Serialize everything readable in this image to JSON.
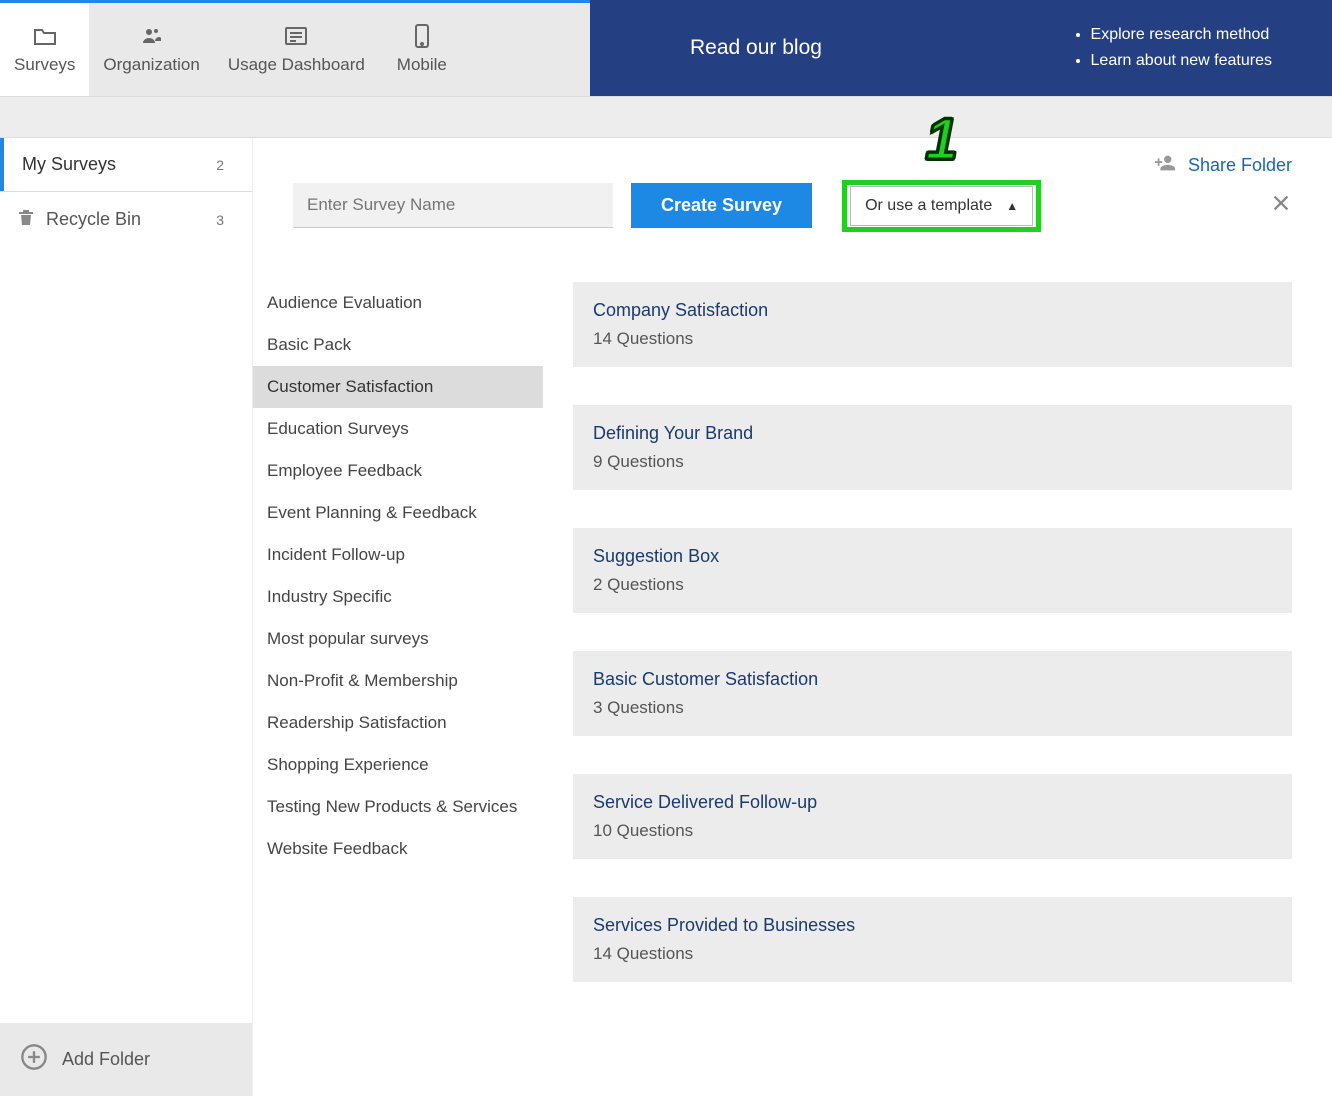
{
  "topnav": [
    {
      "label": "Surveys",
      "icon": "folder",
      "active": true
    },
    {
      "label": "Organization",
      "icon": "people",
      "active": false
    },
    {
      "label": "Usage Dashboard",
      "icon": "list",
      "active": false
    },
    {
      "label": "Mobile",
      "icon": "phone",
      "active": false
    }
  ],
  "bluebox": {
    "blog": "Read our blog",
    "items": [
      "Explore research method",
      "Learn about new features"
    ]
  },
  "sidebar": {
    "items": [
      {
        "label": "My Surveys",
        "count": "2",
        "active": true,
        "icon": ""
      },
      {
        "label": "Recycle Bin",
        "count": "3",
        "active": false,
        "icon": "trash"
      }
    ],
    "add_folder": "Add Folder"
  },
  "header": {
    "share_folder": "Share Folder"
  },
  "action": {
    "placeholder": "Enter Survey Name",
    "create": "Create Survey",
    "template": "Or use a template"
  },
  "annotation": "1",
  "categories": [
    "Audience Evaluation",
    "Basic Pack",
    "Customer Satisfaction",
    "Education Surveys",
    "Employee Feedback",
    "Event Planning & Feedback",
    "Incident Follow-up",
    "Industry Specific",
    "Most popular surveys",
    "Non-Profit & Membership",
    "Readership Satisfaction",
    "Shopping Experience",
    "Testing New Products & Services",
    "Website Feedback"
  ],
  "selected_category": "Customer Satisfaction",
  "templates": [
    {
      "title": "Company Satisfaction",
      "sub": "14 Questions"
    },
    {
      "title": "Defining Your Brand",
      "sub": "9 Questions"
    },
    {
      "title": "Suggestion Box",
      "sub": "2 Questions"
    },
    {
      "title": "Basic Customer Satisfaction",
      "sub": "3 Questions"
    },
    {
      "title": "Service Delivered Follow-up",
      "sub": "10 Questions"
    },
    {
      "title": "Services Provided to Businesses",
      "sub": "14 Questions"
    }
  ]
}
